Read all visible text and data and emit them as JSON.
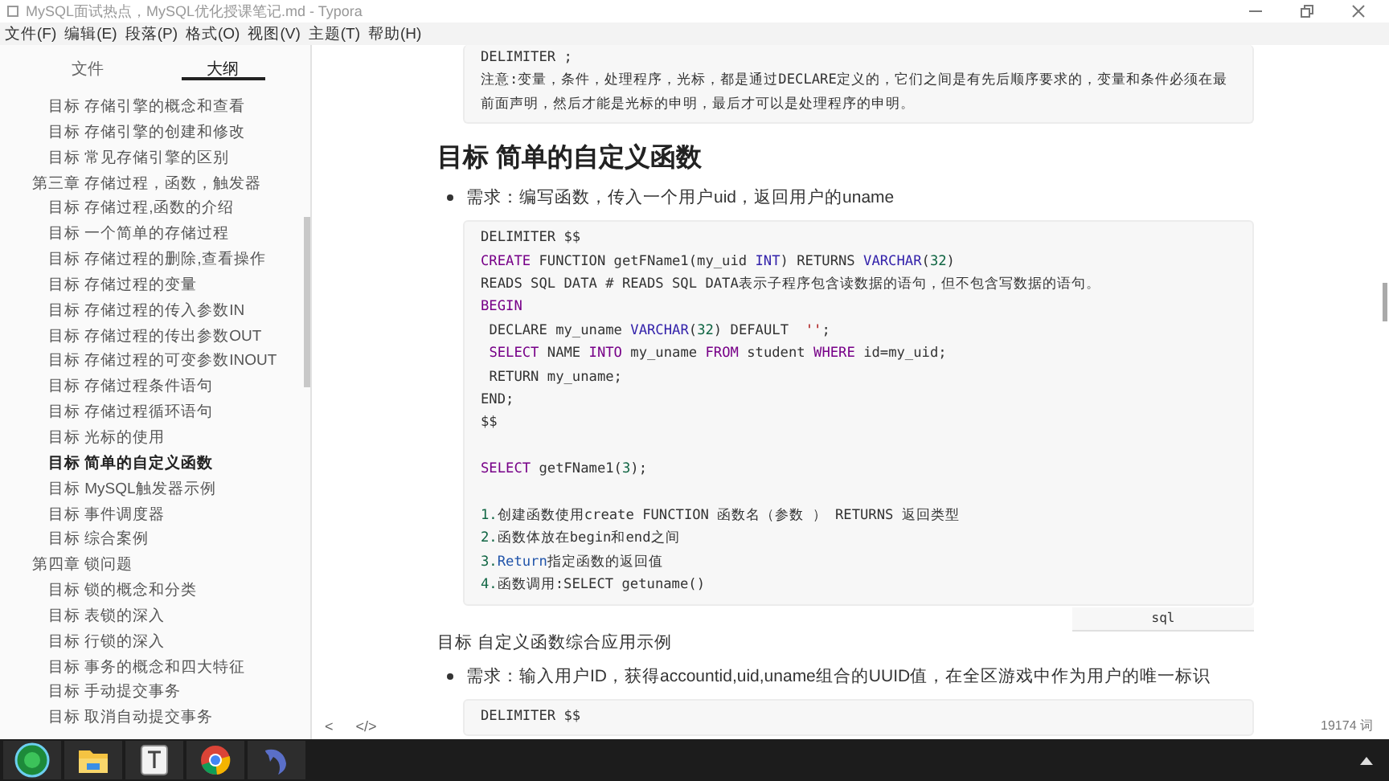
{
  "window": {
    "title": "MySQL面试热点，MySQL优化授课笔记.md - Typora"
  },
  "menu": [
    "文件(F)",
    "编辑(E)",
    "段落(P)",
    "格式(O)",
    "视图(V)",
    "主题(T)",
    "帮助(H)"
  ],
  "sidebar": {
    "tabs": [
      {
        "label": "文件",
        "selected": false
      },
      {
        "label": "大纲",
        "selected": true
      }
    ],
    "outline": [
      {
        "children": [
          {
            "label": "目标 存储引擎的概念和查看",
            "selected": false
          },
          {
            "label": "目标 存储引擎的创建和修改",
            "selected": false
          },
          {
            "label": "目标 常见存储引擎的区别",
            "selected": false
          }
        ]
      },
      {
        "label": "第三章 存储过程，函数，触发器",
        "selected": false,
        "children": [
          {
            "label": "目标 存储过程,函数的介绍",
            "selected": false
          },
          {
            "label": "目标 一个简单的存储过程",
            "selected": false
          },
          {
            "label": "目标 存储过程的删除,查看操作",
            "selected": false
          },
          {
            "label": "目标 存储过程的变量",
            "selected": false
          },
          {
            "label": "目标 存储过程的传入参数IN",
            "selected": false
          },
          {
            "label": "目标 存储过程的传出参数OUT",
            "selected": false
          },
          {
            "label": "目标 存储过程的可变参数INOUT",
            "selected": false
          },
          {
            "label": "目标 存储过程条件语句",
            "selected": false
          },
          {
            "label": "目标 存储过程循环语句",
            "selected": false
          },
          {
            "label": "目标 光标的使用",
            "selected": false
          },
          {
            "label": "目标 简单的自定义函数",
            "selected": true
          },
          {
            "label": "目标 MySQL触发器示例",
            "selected": false
          },
          {
            "label": "目标 事件调度器",
            "selected": false
          },
          {
            "label": "目标 综合案例",
            "selected": false
          }
        ]
      },
      {
        "label": "第四章 锁问题",
        "selected": false,
        "children": [
          {
            "label": "目标 锁的概念和分类",
            "selected": false
          },
          {
            "label": "目标 表锁的深入",
            "selected": false
          },
          {
            "label": "目标 行锁的深入",
            "selected": false
          },
          {
            "label": "目标 事务的概念和四大特征",
            "selected": false
          },
          {
            "label": "目标 手动提交事务",
            "selected": false
          },
          {
            "label": "目标 取消自动提交事务",
            "selected": false
          }
        ]
      }
    ]
  },
  "document": [
    {
      "kind": "code",
      "lines": [
        {
          "kind": "code",
          "parts": [
            {
              "kind": "plain",
              "text": "DELIMITER ;"
            }
          ]
        },
        {
          "kind": "code",
          "parts": [
            {
              "kind": "plain",
              "text": "注意:变量，条件，处理程序，光标，都是通过DECLARE定义的，它们之间是有先后顺序要求的，变量和条件必须在最前面声明，然后才能是光标的申明，最后才可以是处理程序的申明。"
            }
          ]
        }
      ]
    },
    {
      "kind": "heading",
      "text": "目标 简单的自定义函数"
    },
    {
      "kind": "bullet",
      "text": "需求：编写函数，传入一个用户uid，返回用户的uname"
    },
    {
      "kind": "code",
      "language": "sql",
      "lines": [
        {
          "kind": "code",
          "parts": [
            {
              "kind": "plain",
              "text": "DELIMITER $$"
            }
          ]
        },
        {
          "kind": "code",
          "parts": [
            {
              "kind": "kw",
              "text": "CREATE"
            },
            {
              "kind": "plain",
              "text": " FUNCTION getFName1(my_uid "
            },
            {
              "kind": "type",
              "text": "INT"
            },
            {
              "kind": "plain",
              "text": ") RETURNS "
            },
            {
              "kind": "type",
              "text": "VARCHAR"
            },
            {
              "kind": "plain",
              "text": "("
            },
            {
              "kind": "num",
              "text": "32"
            },
            {
              "kind": "plain",
              "text": ")"
            }
          ]
        },
        {
          "kind": "code",
          "parts": [
            {
              "kind": "plain",
              "text": "READS SQL DATA # READS SQL DATA表示子程序包含读数据的语句，但不包含写数据的语句。"
            }
          ]
        },
        {
          "kind": "code",
          "parts": [
            {
              "kind": "kw",
              "text": "BEGIN"
            }
          ]
        },
        {
          "kind": "code",
          "parts": [
            {
              "kind": "plain",
              "text": " DECLARE my_uname "
            },
            {
              "kind": "type",
              "text": "VARCHAR"
            },
            {
              "kind": "plain",
              "text": "("
            },
            {
              "kind": "num",
              "text": "32"
            },
            {
              "kind": "plain",
              "text": ") DEFAULT  "
            },
            {
              "kind": "str",
              "text": "''"
            },
            {
              "kind": "plain",
              "text": ";"
            }
          ]
        },
        {
          "kind": "code",
          "parts": [
            {
              "kind": "kw",
              "text": " SELECT"
            },
            {
              "kind": "plain",
              "text": " NAME "
            },
            {
              "kind": "kw",
              "text": "INTO"
            },
            {
              "kind": "plain",
              "text": " my_uname "
            },
            {
              "kind": "kw",
              "text": "FROM"
            },
            {
              "kind": "plain",
              "text": " student "
            },
            {
              "kind": "kw",
              "text": "WHERE"
            },
            {
              "kind": "plain",
              "text": " id=my_uid;"
            }
          ]
        },
        {
          "kind": "code",
          "parts": [
            {
              "kind": "plain",
              "text": " RETURN my_uname;"
            }
          ]
        },
        {
          "kind": "code",
          "parts": [
            {
              "kind": "plain",
              "text": "END;"
            }
          ]
        },
        {
          "kind": "code",
          "parts": [
            {
              "kind": "plain",
              "text": "$$"
            }
          ]
        },
        {
          "kind": "blank"
        },
        {
          "kind": "code",
          "parts": [
            {
              "kind": "kw",
              "text": "SELECT"
            },
            {
              "kind": "plain",
              "text": " getFName1("
            },
            {
              "kind": "num",
              "text": "3"
            },
            {
              "kind": "plain",
              "text": ");"
            }
          ]
        },
        {
          "kind": "blank"
        },
        {
          "kind": "code",
          "parts": [
            {
              "kind": "num",
              "text": "1."
            },
            {
              "kind": "plain",
              "text": "创建函数使用create FUNCTION 函数名（参数 ） RETURNS 返回类型"
            }
          ]
        },
        {
          "kind": "code",
          "parts": [
            {
              "kind": "num",
              "text": "2."
            },
            {
              "kind": "plain",
              "text": "函数体放在begin和end之间"
            }
          ]
        },
        {
          "kind": "code",
          "parts": [
            {
              "kind": "num",
              "text": "3."
            },
            {
              "kind": "link",
              "text": "Return"
            },
            {
              "kind": "plain",
              "text": "指定函数的返回值"
            }
          ]
        },
        {
          "kind": "code",
          "parts": [
            {
              "kind": "num",
              "text": "4."
            },
            {
              "kind": "plain",
              "text": "函数调用:SELECT getuname()"
            }
          ]
        }
      ]
    },
    {
      "kind": "paragraph",
      "text": "目标 自定义函数综合应用示例"
    },
    {
      "kind": "bullet",
      "text": "需求：输入用户ID，获得accountid,uid,uname组合的UUID值，在全区游戏中作为用户的唯一标识"
    },
    {
      "kind": "code",
      "lines": [
        {
          "kind": "code",
          "parts": [
            {
              "kind": "plain",
              "text": "DELIMITER $$"
            }
          ]
        }
      ]
    }
  ],
  "status_bar": {
    "left": [
      "<",
      "</>"
    ],
    "word_count": "19174 词"
  }
}
